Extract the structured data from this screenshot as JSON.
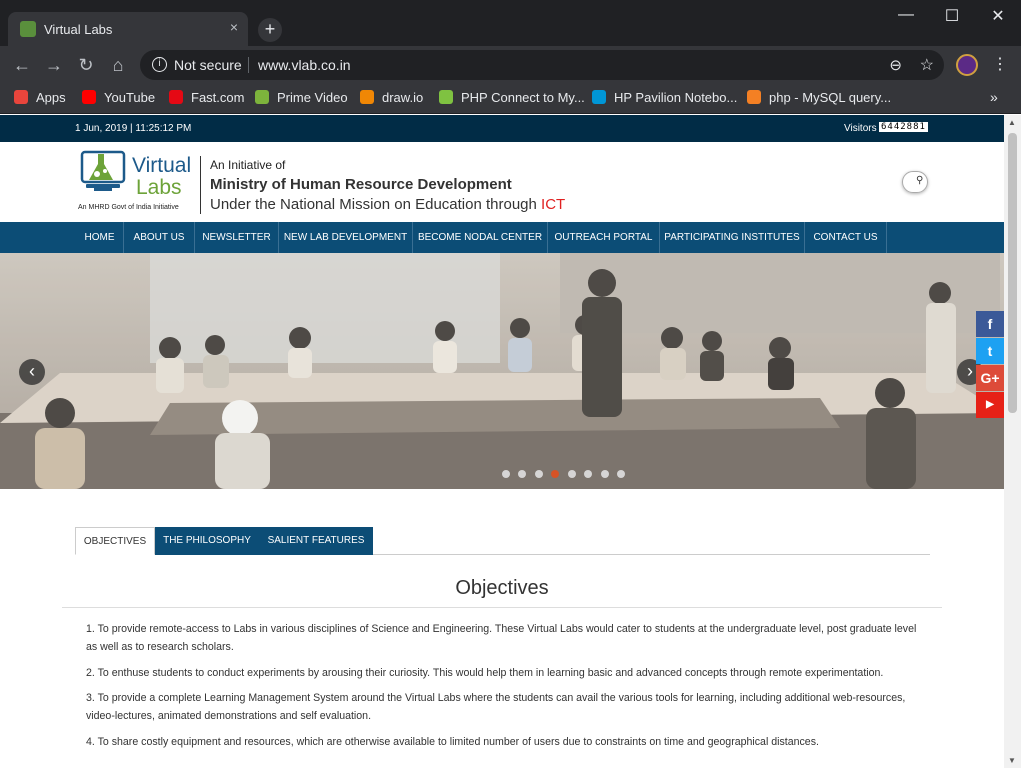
{
  "browser": {
    "tab_title": "Virtual Labs",
    "tab_close": "×",
    "new_tab": "+",
    "win_min": "—",
    "win_max": "☐",
    "win_close": "✕",
    "back": "←",
    "forward": "→",
    "reload": "↻",
    "home": "⌂",
    "security_label": "Not secure",
    "url": "www.vlab.co.in",
    "bookmarks": [
      {
        "label": "Apps",
        "color": "#e8453c"
      },
      {
        "label": "YouTube",
        "color": "#ff0000"
      },
      {
        "label": "Fast.com",
        "color": "#e50914"
      },
      {
        "label": "Prime Video",
        "color": "#7db33c"
      },
      {
        "label": "draw.io",
        "color": "#f08705"
      },
      {
        "label": "PHP Connect to My...",
        "color": "#7fc241"
      },
      {
        "label": "HP Pavilion Notebo...",
        "color": "#0096d6"
      },
      {
        "label": "php - MySQL query...",
        "color": "#f48024"
      }
    ],
    "bookmarks_more": "»"
  },
  "site": {
    "datetime": "1 Jun, 2019 | 11:25:12 PM",
    "visitors_label": "Visitors",
    "visitors_count": "6442881",
    "logo_line1": "Virtual",
    "logo_line2": "Labs",
    "logo_tagline": "An MHRD Govt of India Initiative",
    "initiative_of": "An Initiative of",
    "ministry": "Ministry of Human Resource Development",
    "mission_prefix": "Under the National Mission on Education through ",
    "mission_ict": "ICT",
    "nav": [
      "HOME",
      "ABOUT US",
      "NEWSLETTER",
      "NEW LAB DEVELOPMENT",
      "BECOME NODAL CENTER",
      "OUTREACH PORTAL",
      "PARTICIPATING INSTITUTES",
      "CONTACT US"
    ],
    "carousel": {
      "total_slides": 8,
      "active_slide": 4,
      "prev": "‹",
      "next": "›"
    },
    "social": [
      {
        "name": "facebook",
        "glyph": "f",
        "color": "#3b5998"
      },
      {
        "name": "twitter",
        "glyph": "t",
        "color": "#1da1f2"
      },
      {
        "name": "google-plus",
        "glyph": "G+",
        "color": "#dd4b39"
      },
      {
        "name": "youtube",
        "glyph": "▶",
        "color": "#e62117"
      }
    ],
    "tabs": [
      "OBJECTIVES",
      "THE PHILOSOPHY",
      "SALIENT FEATURES"
    ],
    "active_tab": "OBJECTIVES",
    "objectives_title": "Objectives",
    "objectives": [
      "1. To provide remote-access to Labs in various disciplines of Science and Engineering. These Virtual Labs would cater to students at the undergraduate level, post graduate level as well as to research scholars.",
      "2. To enthuse students to conduct experiments by arousing their curiosity. This would help them in learning basic and advanced concepts through remote experimentation.",
      "3. To provide a complete Learning Management System around the Virtual Labs where the students can avail the various tools for learning, including additional web-resources, video-lectures, animated demonstrations and self evaluation.",
      "4. To share costly equipment and resources, which are otherwise available to limited number of users due to constraints on time and geographical distances."
    ]
  }
}
